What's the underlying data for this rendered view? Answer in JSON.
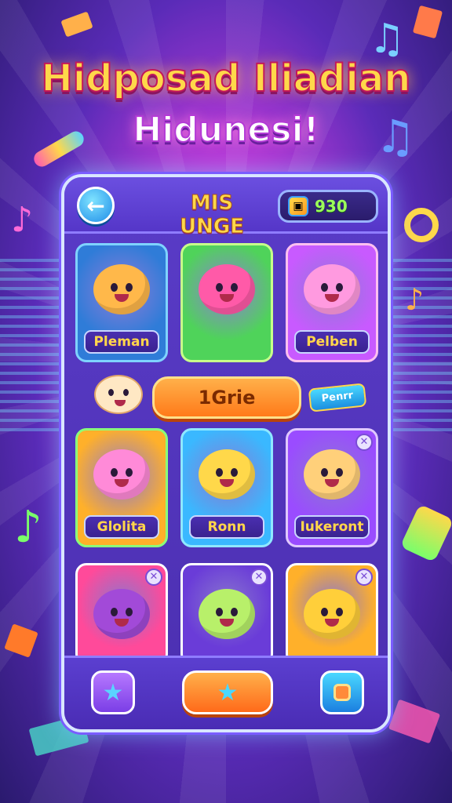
{
  "title": {
    "line1": "Hidposad Iliadian",
    "line2": "Hidunesi!"
  },
  "header": {
    "back_icon": "arrow-left-icon",
    "title": "MIS UNGE",
    "currency_icon": "gift-box-icon",
    "currency_value": "930"
  },
  "cards_row1": [
    {
      "label": "Pleman",
      "color": "#2f7cd8",
      "creature": "#ffb84a",
      "border": "#7fd3ff"
    },
    {
      "label": "",
      "color": "#4fd35a",
      "creature": "#ff5aa8",
      "border": "#c8ff8a"
    },
    {
      "label": "Pelben",
      "color": "#c85aff",
      "creature": "#ff9ae0",
      "border": "#ffc0f0"
    }
  ],
  "middle": {
    "button_label": "1Grie",
    "tag_label": "Penrr"
  },
  "cards_row2": [
    {
      "label": "Glolita",
      "color": "#ffb02a",
      "creature": "#ff8ad8",
      "border": "#8aff7a"
    },
    {
      "label": "Ronn",
      "color": "#3ab8ff",
      "creature": "#ffd84a",
      "border": "#8fe8ff"
    },
    {
      "label": "Iukeront",
      "color": "#9a4cff",
      "creature": "#ffd07a",
      "border": "#e0c8ff"
    }
  ],
  "cards_row3": [
    {
      "color": "#ff4a9a",
      "creature": "#a24ad8"
    },
    {
      "color": "#6a3cd8",
      "creature": "#b8f06a"
    },
    {
      "color": "#ffb02a",
      "creature": "#ffcf3a"
    }
  ],
  "bottom_nav": {
    "left_icon": "star-icon",
    "center_icon": "star-icon",
    "right_icon": "camera-icon"
  }
}
